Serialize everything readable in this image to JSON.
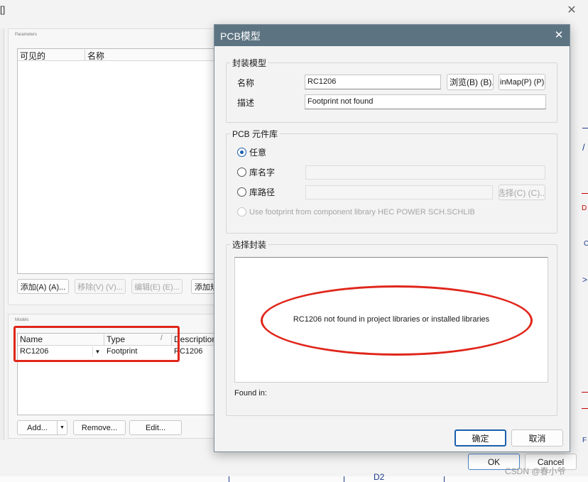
{
  "background_dialog": {
    "title_fragment": "[]",
    "parameters": {
      "section_label": "Parameters",
      "columns": [
        "可见的",
        "名称"
      ],
      "buttons": {
        "add": "添加(A) (A)...",
        "remove": "移除(V) (V)...",
        "edit": "编辑(E) (E)...",
        "add_rule": "添加规"
      }
    },
    "models": {
      "section_label": "Models",
      "columns": [
        "Name",
        "Type",
        "Description"
      ],
      "sort_indicator": "/",
      "row": {
        "name": "RC1206",
        "type": "Footprint",
        "description": "RC1206"
      },
      "buttons": {
        "add": "Add...",
        "remove": "Remove...",
        "edit": "Edit..."
      }
    },
    "footer": {
      "ok": "OK",
      "cancel": "Cancel"
    }
  },
  "schematic_fragment": {
    "label": "D2"
  },
  "pcb_dialog": {
    "title": "PCB模型",
    "footprint_model": {
      "group_title": "封装模型",
      "name_label": "名称",
      "name_value": "RC1206",
      "description_label": "描述",
      "description_value": "Footprint not found",
      "browse_button": "浏览(B) (B)...",
      "pin_map_button": "inMap(P) (P)..."
    },
    "pcb_library": {
      "group_title": "PCB 元件库",
      "options": [
        {
          "label": "任意",
          "checked": true,
          "enabled": true
        },
        {
          "label": "库名字",
          "checked": false,
          "enabled": true
        },
        {
          "label": "库路径",
          "checked": false,
          "enabled": true
        },
        {
          "label": "Use footprint from component library HEC POWER SCH.SCHLIB",
          "checked": false,
          "enabled": false
        }
      ],
      "choose_button": "选择(C) (C)..."
    },
    "select_footprint": {
      "group_title": "选择封装",
      "message": "RC1206 not found in project libraries or installed libraries",
      "found_in_label": "Found in:"
    },
    "buttons": {
      "ok": "确定",
      "cancel": "取消"
    }
  },
  "watermark": "CSDN @春小爷",
  "colors": {
    "annotation_red": "#e0261b",
    "accent_blue": "#1b5fad",
    "titlebar": "#5c7382"
  }
}
